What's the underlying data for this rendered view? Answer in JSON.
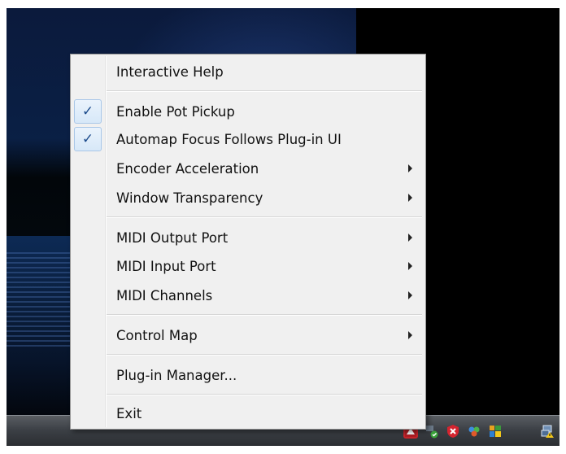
{
  "menu": {
    "items": [
      {
        "label": "Interactive Help",
        "checked": false,
        "submenu": false
      },
      {
        "label": "Enable Pot Pickup",
        "checked": true,
        "submenu": false
      },
      {
        "label": "Automap Focus Follows Plug-in UI",
        "checked": true,
        "submenu": false
      },
      {
        "label": "Encoder Acceleration",
        "checked": false,
        "submenu": true
      },
      {
        "label": "Window Transparency",
        "checked": false,
        "submenu": true
      },
      {
        "label": "MIDI Output Port",
        "checked": false,
        "submenu": true
      },
      {
        "label": "MIDI Input Port",
        "checked": false,
        "submenu": true
      },
      {
        "label": "MIDI Channels",
        "checked": false,
        "submenu": true
      },
      {
        "label": "Control Map",
        "checked": false,
        "submenu": true
      },
      {
        "label": "Plug-in Manager...",
        "checked": false,
        "submenu": false
      },
      {
        "label": "Exit",
        "checked": false,
        "submenu": false
      }
    ],
    "check_glyph": "✓"
  },
  "taskbar": {
    "tray_icons": [
      "automap-icon",
      "network-check-icon",
      "security-shield-icon",
      "people-icon",
      "windows-flag-icon",
      "network-warning-icon"
    ]
  },
  "colors": {
    "menu_bg": "#f0f0f0",
    "check_highlight": "#d7e8f8",
    "check_color": "#1d4c8c"
  }
}
